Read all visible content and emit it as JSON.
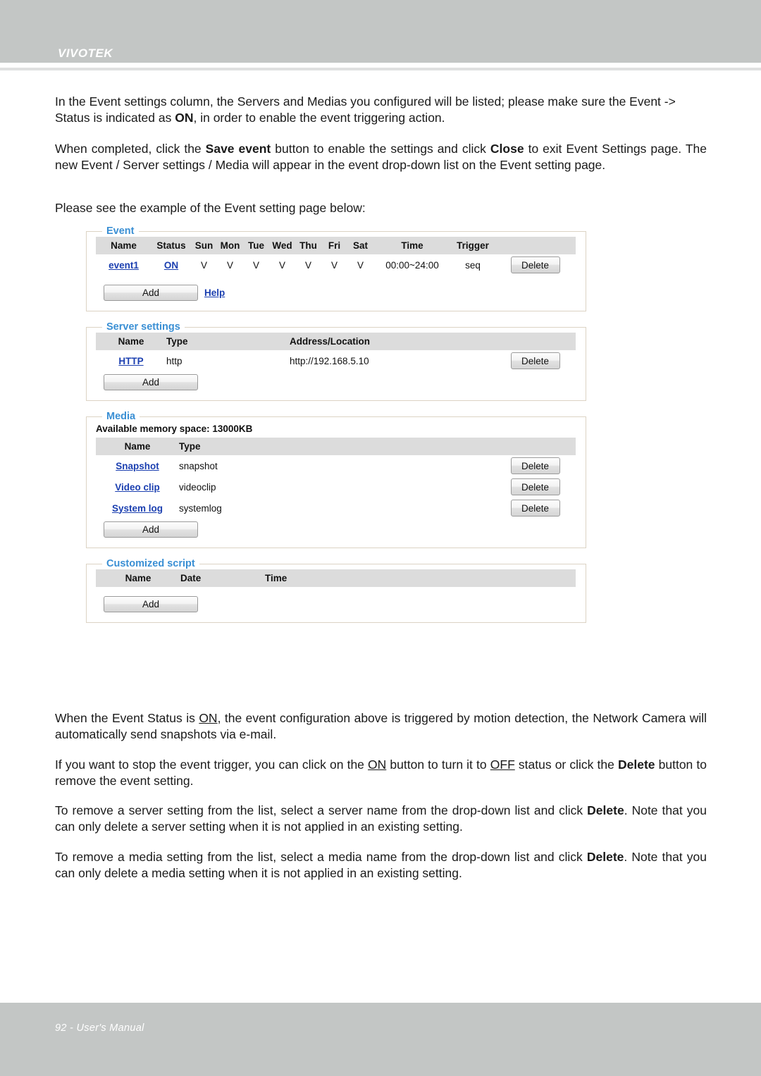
{
  "header": {
    "brand": "VIVOTEK"
  },
  "footer": {
    "page_label": "92 - User's Manual"
  },
  "body": {
    "para1_a": "In the Event settings column, the Servers and Medias you configured will be listed; please make sure the Event -> Status is indicated as ",
    "para1_on": "ON",
    "para1_b": ", in order to enable the event triggering action.",
    "para2_a": "When completed, click the ",
    "para2_save": "Save event",
    "para2_b": " button to enable the settings and click ",
    "para2_close": "Close",
    "para2_c": " to exit Event Settings page. The new Event / Server settings / Media will appear in the event drop-down list on the Event setting page.",
    "para3": "Please see the example of the Event setting page below:",
    "para4_a": "When the Event Status is ",
    "para4_on": "ON",
    "para4_b": ", the event configuration above is triggered by motion detection, the Network Camera will  automatically send snapshots via e-mail.",
    "para5_a": "If you want to stop the event trigger, you can click on the ",
    "para5_on": "ON",
    "para5_b": " button to turn it to ",
    "para5_off": "OFF",
    "para5_c": " status or click the ",
    "para5_delete": "Delete",
    "para5_d": " button to remove the event setting.",
    "para6_a": "To remove a server setting from the list, select a server name from the drop-down list and click ",
    "para6_delete": "Delete",
    "para6_b": ". Note that you can only delete a server setting when it is not applied in an existing setting.",
    "para7_a": "To remove a media setting from the list, select a media name from the drop-down list and click ",
    "para7_delete": "Delete",
    "para7_b": ". Note that you can only delete a media setting when it is not applied in an existing setting."
  },
  "figure": {
    "event_panel": {
      "legend": "Event",
      "columns": [
        "Name",
        "Status",
        "Sun",
        "Mon",
        "Tue",
        "Wed",
        "Thu",
        "Fri",
        "Sat",
        "Time",
        "Trigger",
        ""
      ],
      "rows": [
        {
          "name": "event1",
          "status": "ON",
          "sun": "V",
          "mon": "V",
          "tue": "V",
          "wed": "V",
          "thu": "V",
          "fri": "V",
          "sat": "V",
          "time": "00:00~24:00",
          "trigger": "seq",
          "delete_label": "Delete"
        }
      ],
      "add_label": "Add",
      "help_label": "Help"
    },
    "server_panel": {
      "legend": "Server settings",
      "columns": [
        "Name",
        "Type",
        "Address/Location",
        ""
      ],
      "rows": [
        {
          "name": "HTTP",
          "type": "http",
          "address": "http://192.168.5.10",
          "delete_label": "Delete"
        }
      ],
      "add_label": "Add"
    },
    "media_panel": {
      "legend": "Media",
      "memory_line": "Available memory space: 13000KB",
      "columns": [
        "Name",
        "Type",
        ""
      ],
      "rows": [
        {
          "name": "Snapshot",
          "type": "snapshot",
          "delete_label": "Delete"
        },
        {
          "name": "Video clip",
          "type": "videoclip",
          "delete_label": "Delete"
        },
        {
          "name": "System log",
          "type": "systemlog",
          "delete_label": "Delete"
        }
      ],
      "add_label": "Add"
    },
    "script_panel": {
      "legend": "Customized script",
      "columns": [
        "Name",
        "Date",
        "Time",
        ""
      ],
      "rows": [],
      "add_label": "Add"
    }
  },
  "colors": {
    "band": "#c3c6c5",
    "legend_blue": "#3a8fd4",
    "link_blue": "#1b3fb0",
    "table_header_gray": "#dcdcdc",
    "panel_border": "#dcd3c4"
  }
}
